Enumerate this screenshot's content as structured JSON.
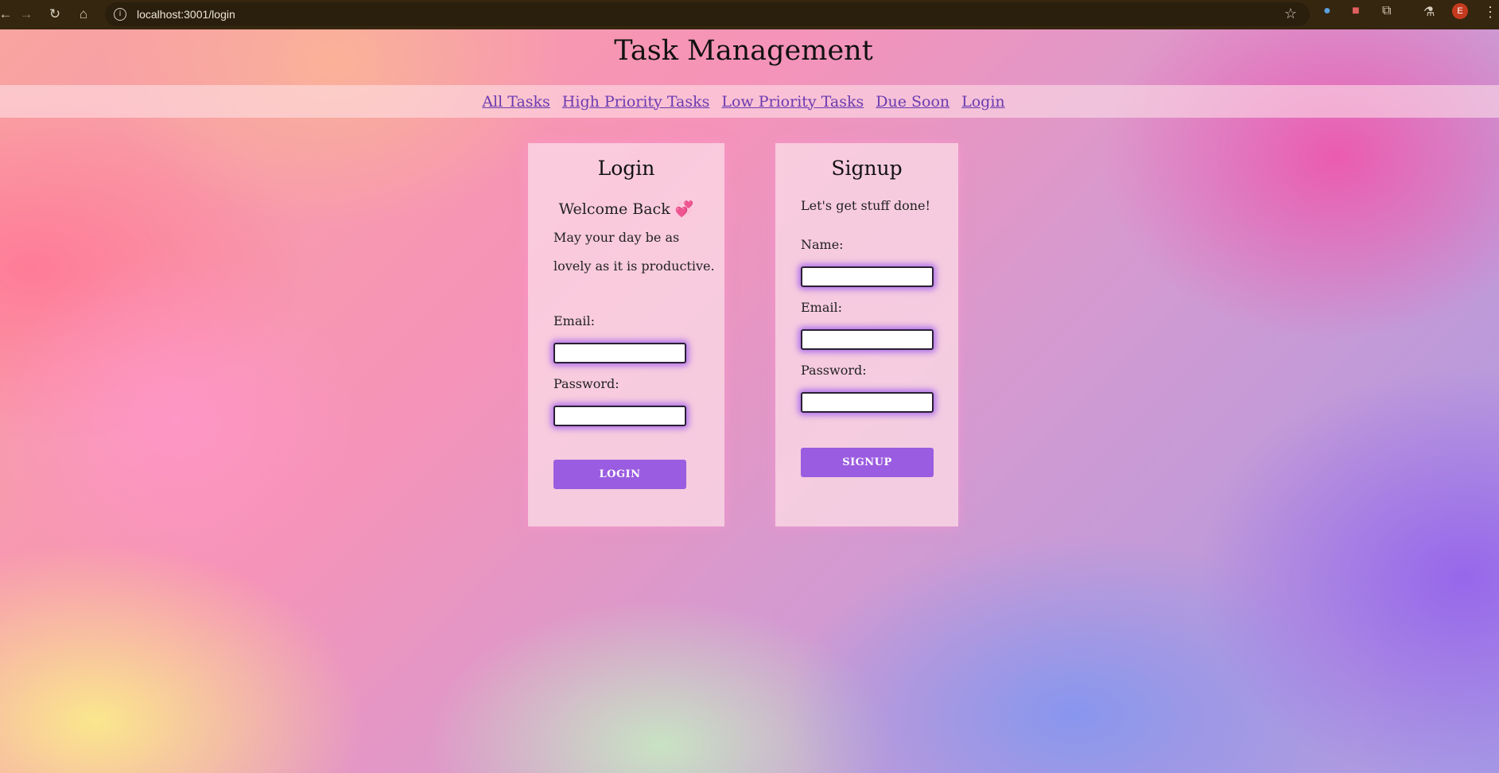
{
  "browser": {
    "url": "localhost:3001/login",
    "profile_initial": "E",
    "colors": {
      "bar": "#35260f",
      "avatar": "#c43a1e"
    },
    "icons": [
      "back-icon",
      "forward-icon",
      "reload-icon",
      "home-icon",
      "site-info-icon",
      "bookmark-star-icon",
      "extension-icon",
      "labs-icon",
      "menu-icon"
    ]
  },
  "header": {
    "title": "Task Management"
  },
  "nav": {
    "items": [
      {
        "label": "All Tasks"
      },
      {
        "label": "High Priority Tasks"
      },
      {
        "label": "Low Priority Tasks"
      },
      {
        "label": "Due Soon"
      },
      {
        "label": "Login"
      }
    ],
    "link_color": "#6a3ab0"
  },
  "login": {
    "title": "Login",
    "welcome": "Welcome Back 💞",
    "message_line1": "May your day be as",
    "message_line2": "lovely as it is productive.",
    "email_label": "Email:",
    "email_value": "",
    "password_label": "Password:",
    "password_value": "",
    "button_label": "LOGIN"
  },
  "signup": {
    "title": "Signup",
    "tagline": "Let's get stuff done!",
    "name_label": "Name:",
    "name_value": "",
    "email_label": "Email:",
    "email_value": "",
    "password_label": "Password:",
    "password_value": "",
    "button_label": "SIGNUP"
  },
  "colors": {
    "button": "#9a5ce0",
    "input_glow": "#9650f0"
  }
}
